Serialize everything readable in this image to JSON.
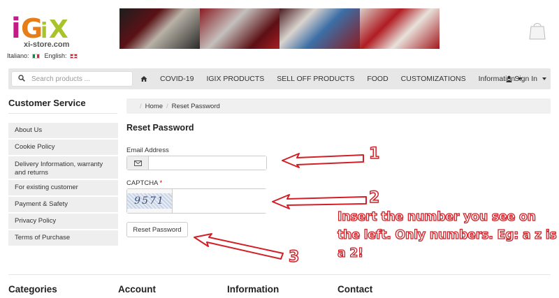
{
  "header": {
    "logo_text": "iGiX",
    "logo_subtitle": "xi-store.com",
    "languages": [
      {
        "label": "Italiano:",
        "flag": "it-flag"
      },
      {
        "label": "English:",
        "flag": "uk-flag"
      }
    ]
  },
  "navbar": {
    "search_placeholder": "Search products ...",
    "items": [
      "COVID-19",
      "IGIX PRODUCTS",
      "SELL OFF PRODUCTS",
      "FOOD",
      "CUSTOMIZATIONS",
      "Information"
    ],
    "signin_label": "Sign In"
  },
  "sidebar": {
    "title": "Customer Service",
    "items": [
      "About Us",
      "Cookie Policy",
      "Delivery Information, warranty and returns",
      "For existing customer",
      "Payment & Safety",
      "Privacy Policy",
      "Terms of Purchase"
    ]
  },
  "breadcrumb": [
    "Home",
    "Reset Password"
  ],
  "form": {
    "title": "Reset Password",
    "email_label": "Email Address",
    "email_value": "",
    "captcha_label": "CAPTCHA",
    "captcha_required_mark": "*",
    "captcha_image_text": "9571",
    "captcha_value": "",
    "submit_label": "Reset Password"
  },
  "annotations": {
    "step1": "1",
    "step2": "2",
    "step3": "3",
    "instruction": "Insert the number you see on the left. Only numbers. Eg: a z is a 2!",
    "color": "#d12027"
  },
  "footer": {
    "columns": [
      "Categories",
      "Account",
      "Information",
      "Contact"
    ]
  }
}
